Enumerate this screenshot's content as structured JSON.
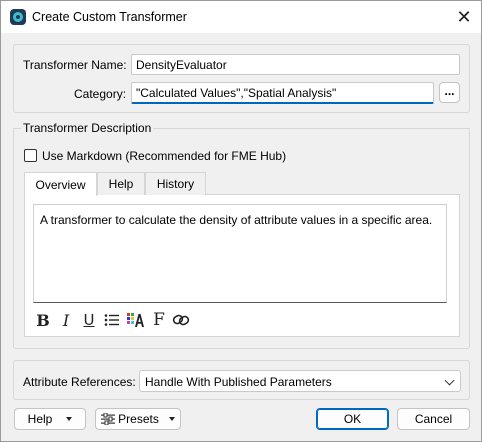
{
  "window": {
    "title": "Create Custom Transformer",
    "close_glyph": "✕"
  },
  "form": {
    "name_label": "Transformer Name:",
    "name_value": "DensityEvaluator",
    "category_label": "Category:",
    "category_value": "\"Calculated Values\",\"Spatial Analysis\"",
    "category_button": "..."
  },
  "description": {
    "section_label": "Transformer Description",
    "markdown_label": "Use Markdown (Recommended for FME Hub)",
    "markdown_checked": false,
    "tabs": [
      {
        "label": "Overview",
        "active": true
      },
      {
        "label": "Help",
        "active": false
      },
      {
        "label": "History",
        "active": false
      }
    ],
    "text": "A transformer to calculate the density of attribute values in a specific area.",
    "format_icons": {
      "bold": "B",
      "italic": "I",
      "underline": "U",
      "font": "F"
    }
  },
  "attributes": {
    "label": "Attribute References:",
    "value": "Handle With Published Parameters"
  },
  "buttons": {
    "help": "Help",
    "presets": "Presets",
    "ok": "OK",
    "cancel": "Cancel"
  },
  "colors": {
    "accent": "#0067c0",
    "window_bg": "#f0f0f0"
  }
}
